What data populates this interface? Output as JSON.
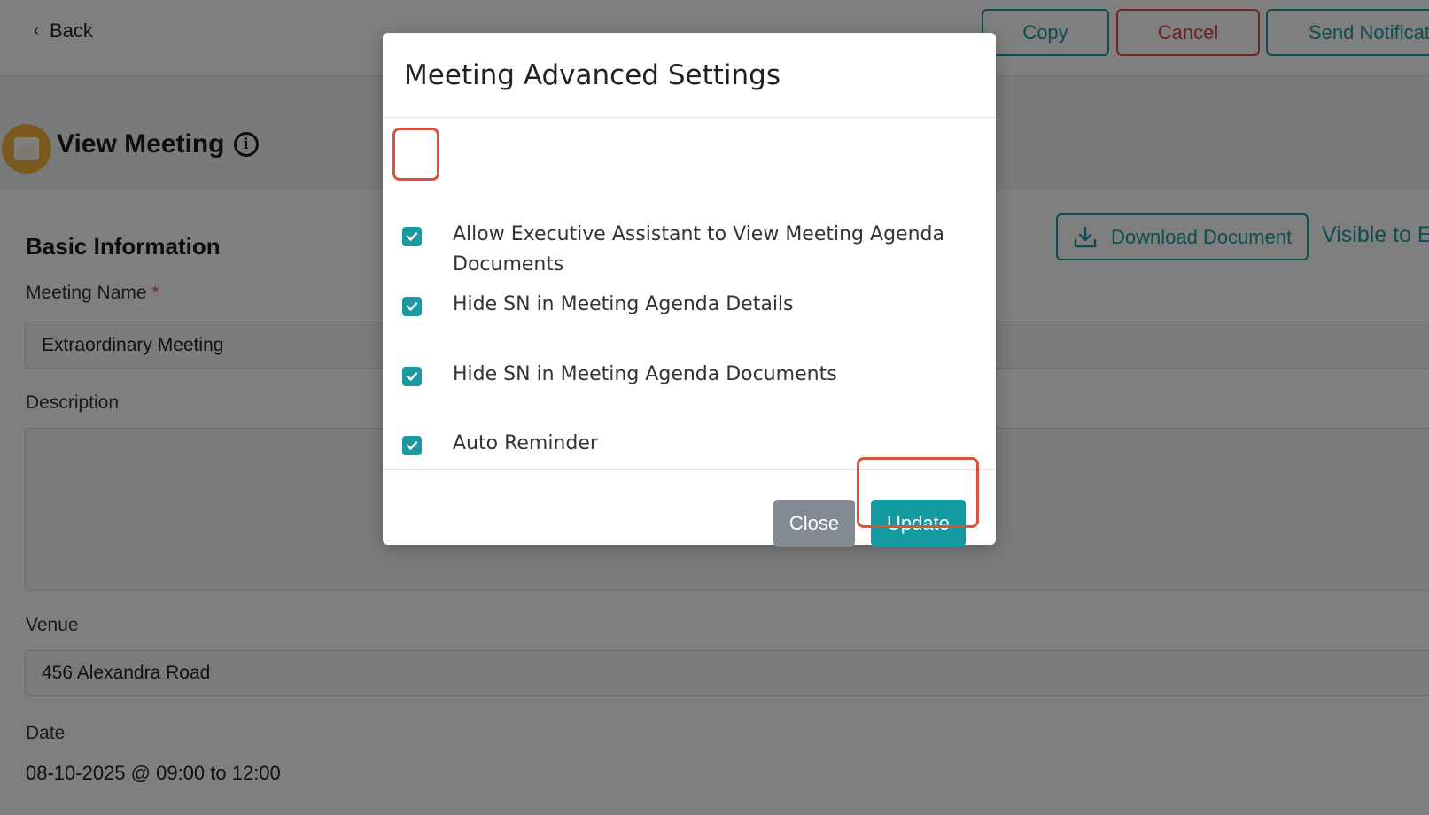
{
  "topbar": {
    "back_label": "Back",
    "copy_label": "Copy",
    "cancel_label": "Cancel",
    "send_label": "Send Notificat"
  },
  "header": {
    "title": "View Meeting",
    "info_glyph": "i"
  },
  "section": {
    "title": "Basic Information",
    "download_label": "Download Document",
    "visible_to": "Visible to E"
  },
  "form": {
    "meeting_name_label": "Meeting Name",
    "required_mark": "*",
    "meeting_name_value": "Extraordinary Meeting",
    "description_label": "Description",
    "description_value": "",
    "venue_label": "Venue",
    "venue_value": "456 Alexandra Road",
    "date_label": "Date",
    "date_value": "08-10-2025 @ 09:00 to 12:00"
  },
  "modal": {
    "title": "Meeting Advanced Settings",
    "options": [
      {
        "label": "Allow Executive Assistant to View Meeting Agenda Documents",
        "checked": true
      },
      {
        "label": "Hide SN in Meeting Agenda Details",
        "checked": true
      },
      {
        "label": "Hide SN in Meeting Agenda Documents",
        "checked": true
      },
      {
        "label": "Auto Reminder",
        "checked": true
      }
    ],
    "close_label": "Close",
    "update_label": "Update"
  },
  "colors": {
    "accent": "#1a9aa0",
    "danger": "#d64545",
    "highlight": "#d9533c",
    "close_button": "#848a91"
  },
  "icons": {
    "back": "chevron-left-icon",
    "calendar": "calendar-icon",
    "info": "info-icon",
    "download": "download-icon",
    "checkbox": "check-icon"
  }
}
